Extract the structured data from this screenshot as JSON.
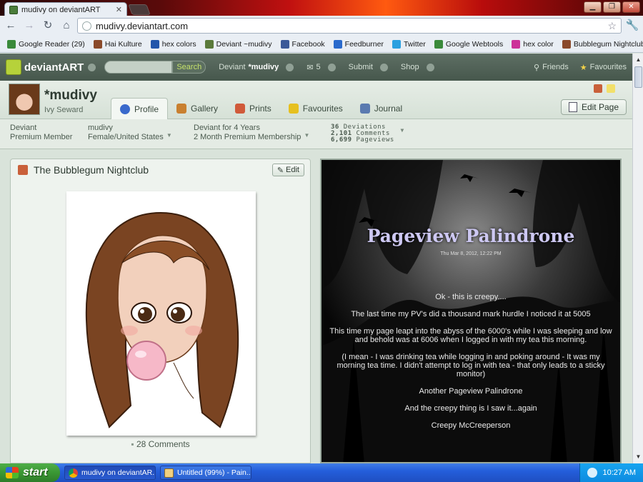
{
  "browser": {
    "tab_title": "mudivy on deviantART",
    "url": "mudivy.deviantart.com",
    "bookmarks": [
      {
        "label": "Google Reader (29)",
        "color": "#3a8a3a"
      },
      {
        "label": "Hai Kulture",
        "color": "#8a4a2a"
      },
      {
        "label": "hex colors",
        "color": "#2255aa"
      },
      {
        "label": "Deviant ~mudivy",
        "color": "#5a7a3a"
      },
      {
        "label": "Facebook",
        "color": "#3b5998"
      },
      {
        "label": "Feedburner",
        "color": "#2a6acc"
      },
      {
        "label": "Twitter",
        "color": "#2aa0e0"
      },
      {
        "label": "Google Webtools",
        "color": "#3a8a3a"
      },
      {
        "label": "hex color",
        "color": "#cc3399"
      },
      {
        "label": "Bubblegum Nightclub",
        "color": "#8a4a2a"
      }
    ],
    "overflow": "»"
  },
  "da_nav": {
    "logo": "deviantART",
    "search_button": "Search",
    "deviant_label": "Deviant",
    "deviant_name": "*mudivy",
    "message_count": "5",
    "submit": "Submit",
    "shop": "Shop",
    "friends": "Friends",
    "favourites": "Favourites"
  },
  "profile": {
    "username": "*mudivy",
    "real_name": "Ivy Seward",
    "tabs": [
      "Profile",
      "Gallery",
      "Prints",
      "Favourites",
      "Journal"
    ],
    "active_tab": "Profile",
    "edit_page": "Edit Page",
    "info": {
      "type_line1": "Deviant",
      "type_line2": "Premium Member",
      "user_line1": "mudivy",
      "user_line2": "Female/United States",
      "tenure_line1": "Deviant for 4 Years",
      "tenure_line2": "2 Month Premium Membership",
      "deviations_count": "36",
      "deviations_label": "Deviations",
      "comments_count": "2,101",
      "comments_label": "Comments",
      "pageviews_count": "6,699",
      "pageviews_label": "Pageviews"
    }
  },
  "widget": {
    "title": "The Bubblegum Nightclub",
    "edit": "Edit",
    "comments": "28 Comments"
  },
  "journal": {
    "title": "Pageview Palindrone",
    "date": "Thu Mar 8, 2012, 12:22 PM",
    "paragraphs": [
      "Ok - this is creepy....",
      "The last time my PV's did a thousand mark hurdle I noticed it at 5005",
      "This time my page leapt into the abyss of the 6000's while I was sleeping and low and behold was at 6006 when I logged in with my tea this morning.",
      "(I mean - I was drinking tea while logging in and poking around - It was my morning tea time. I didn't attempt to log in with tea - that only leads to a sticky monitor)",
      "Another Pageview Palindrone",
      "And the creepy thing is I saw it...again",
      "Creepy McCreeperson"
    ]
  },
  "taskbar": {
    "start": "start",
    "tasks": [
      "mudivy on deviantAR...",
      "Untitled (99%) - Pain..."
    ],
    "clock": "10:27 AM"
  }
}
